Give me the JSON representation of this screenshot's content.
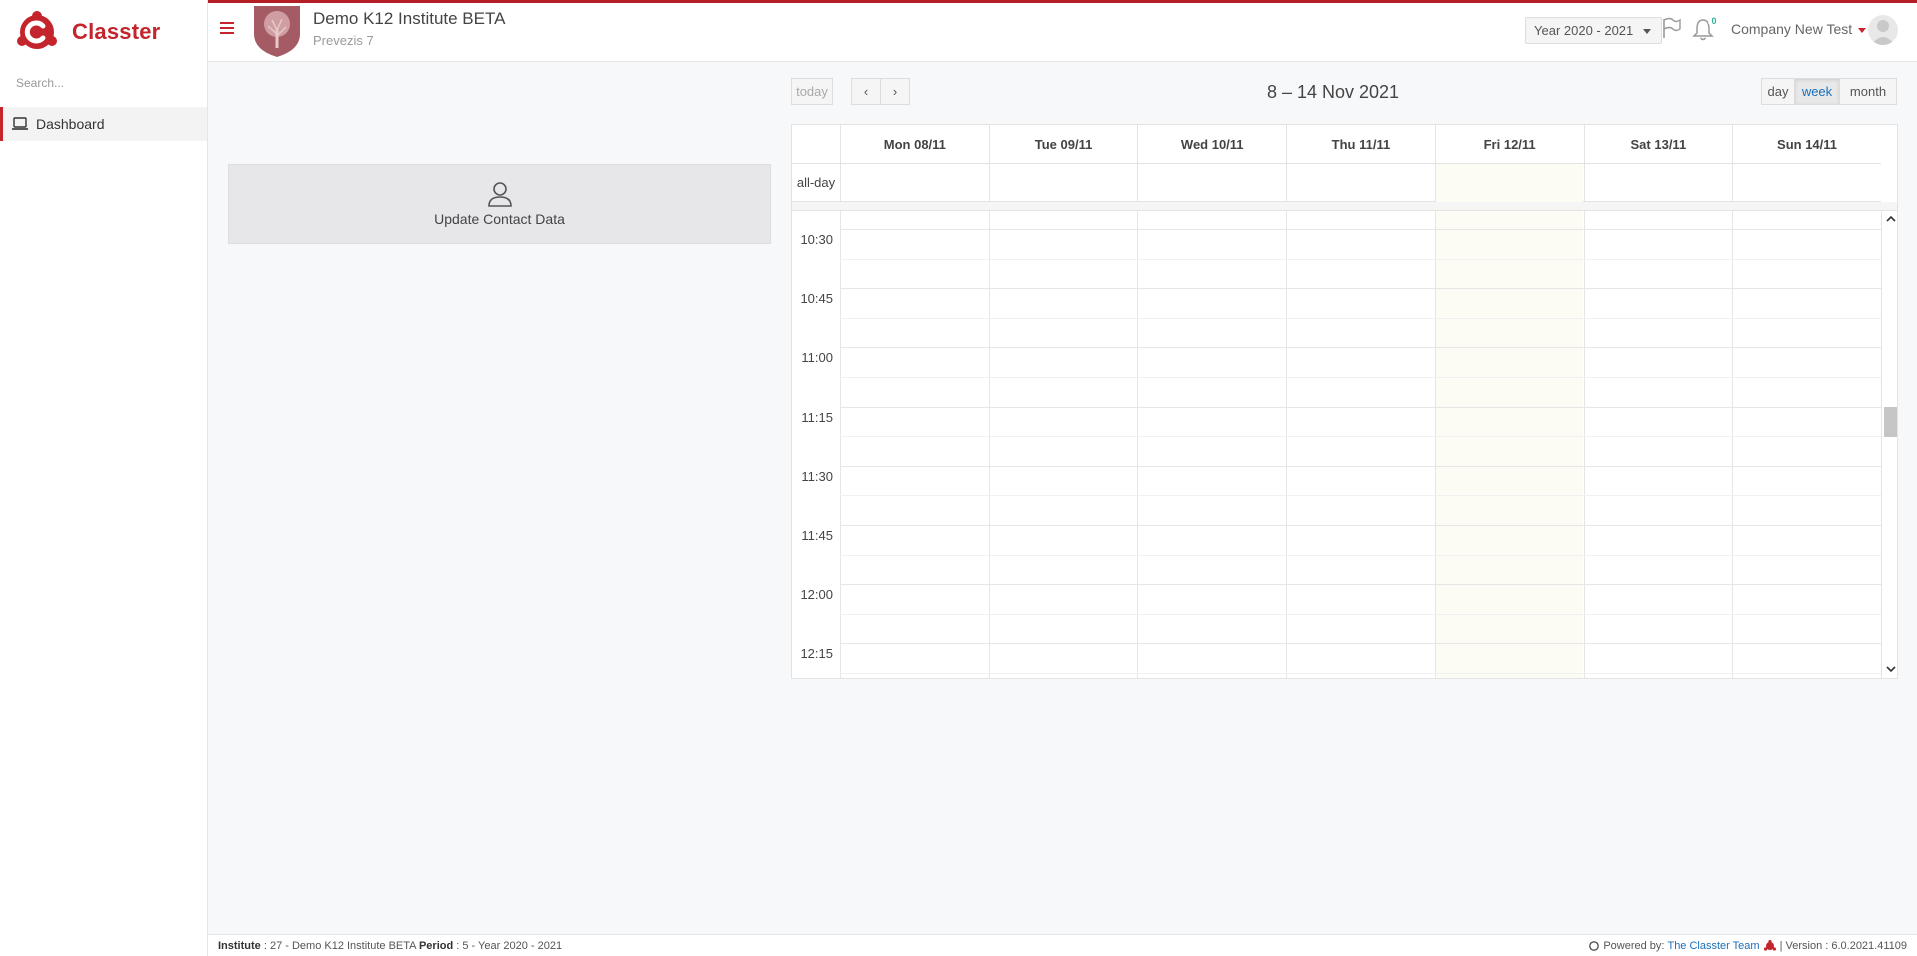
{
  "app": {
    "brand_name": "Classter",
    "accent_color": "#c4242b"
  },
  "sidebar": {
    "search_placeholder": "Search...",
    "items": [
      {
        "label": "Dashboard",
        "icon": "laptop-icon",
        "active": true
      }
    ]
  },
  "header": {
    "school_name": "Demo K12 Institute BETA",
    "school_subtitle": "Prevezis 7",
    "year_select": "Year 2020 - 2021",
    "notification_count": "0",
    "user_name": "Company New Test"
  },
  "widgets": {
    "contact_card_label": "Update Contact Data"
  },
  "calendar": {
    "title": "8 – 14 Nov 2021",
    "buttons": {
      "today": "today",
      "prev": "‹",
      "next": "›",
      "day": "day",
      "week": "week",
      "month": "month"
    },
    "active_view": "week",
    "days": [
      "Mon 08/11",
      "Tue 09/11",
      "Wed 10/11",
      "Thu 11/11",
      "Fri 12/11",
      "Sat 13/11",
      "Sun 14/11"
    ],
    "today_index": 4,
    "allday_label": "all-day",
    "times": [
      "10:30",
      "10:45",
      "11:00",
      "11:15",
      "11:30",
      "11:45",
      "12:00",
      "12:15"
    ]
  },
  "footer": {
    "institute_label": "Institute",
    "institute_value": ": 27 - Demo K12 Institute BETA",
    "period_label": "Period",
    "period_value": ": 5 - Year 2020 - 2021",
    "powered_by": "Powered by:",
    "powered_link": "The Classter Team",
    "version": "| Version : 6.0.2021.41109"
  }
}
